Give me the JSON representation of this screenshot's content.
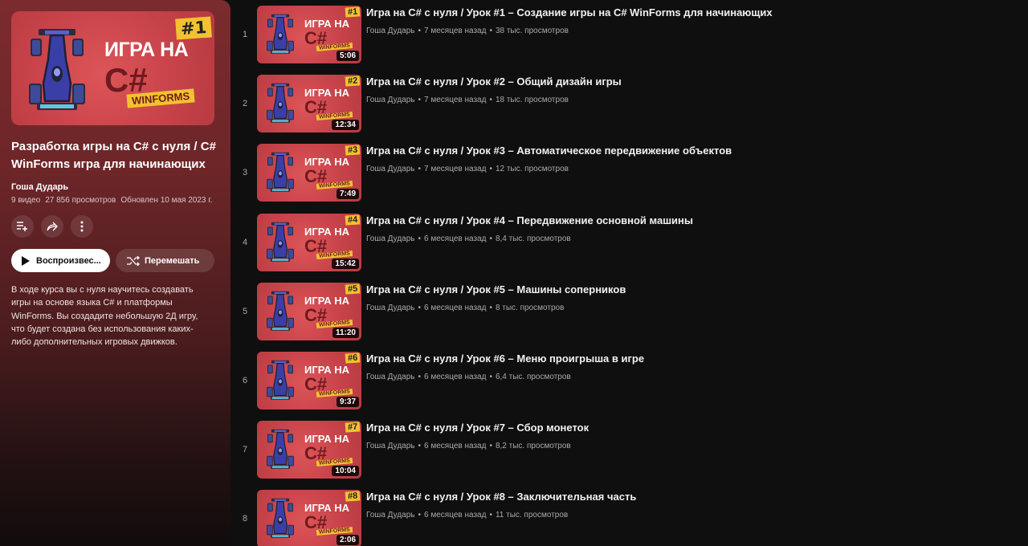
{
  "playlist": {
    "hero": {
      "badge": "#1",
      "title_line1": "ИГРА НА",
      "title_line2": "C#",
      "tag": "WINFORMS"
    },
    "title": "Разработка игры на C# с нуля / C# WinForms игра для начинающих",
    "author": "Гоша Дударь",
    "video_count": "9 видео",
    "views": "27 856 просмотров",
    "updated": "Обновлен 10 мая 2023 г.",
    "play_label": "Воспроизвес...",
    "shuffle_label": "Перемешать",
    "description": "В ходе курса вы с нуля научитесь создавать игры на основе языка C# и платформы WinForms. Вы создадите небольшую 2Д игру, что будет создана без использования каких-либо дополнительных игровых движков."
  },
  "thumb": {
    "line1": "ИГРА НА",
    "line2": "C#",
    "tag": "WINFORMS"
  },
  "videos": [
    {
      "index": "1",
      "badge": "#1",
      "duration": "5:06",
      "title": "Игра на C# с нуля / Урок #1 – Создание игры на C# WinForms для начинающих",
      "author": "Гоша Дударь",
      "age": "7 месяцев назад",
      "views": "38 тыс. просмотров"
    },
    {
      "index": "2",
      "badge": "#2",
      "duration": "12:34",
      "title": "Игра на C# с нуля / Урок #2 – Общий дизайн игры",
      "author": "Гоша Дударь",
      "age": "7 месяцев назад",
      "views": "18 тыс. просмотров"
    },
    {
      "index": "3",
      "badge": "#3",
      "duration": "7:49",
      "title": "Игра на C# с нуля / Урок #3 – Автоматическое передвижение объектов",
      "author": "Гоша Дударь",
      "age": "7 месяцев назад",
      "views": "12 тыс. просмотров"
    },
    {
      "index": "4",
      "badge": "#4",
      "duration": "15:42",
      "title": "Игра на C# с нуля / Урок #4 – Передвижение основной машины",
      "author": "Гоша Дударь",
      "age": "6 месяцев назад",
      "views": "8,4 тыс. просмотров"
    },
    {
      "index": "5",
      "badge": "#5",
      "duration": "11:20",
      "title": "Игра на C# с нуля / Урок #5 – Машины соперников",
      "author": "Гоша Дударь",
      "age": "6 месяцев назад",
      "views": "8 тыс. просмотров"
    },
    {
      "index": "6",
      "badge": "#6",
      "duration": "9:37",
      "title": "Игра на C# с нуля / Урок #6 – Меню проигрыша в игре",
      "author": "Гоша Дударь",
      "age": "6 месяцев назад",
      "views": "6,4 тыс. просмотров"
    },
    {
      "index": "7",
      "badge": "#7",
      "duration": "10:04",
      "title": "Игра на C# с нуля / Урок #7 – Сбор монеток",
      "author": "Гоша Дударь",
      "age": "6 месяцев назад",
      "views": "8,2 тыс. просмотров"
    },
    {
      "index": "8",
      "badge": "#8",
      "duration": "2:06",
      "title": "Игра на C# с нуля / Урок #8 – Заключительная часть",
      "author": "Гоша Дударь",
      "age": "6 месяцев назад",
      "views": "11 тыс. просмотров"
    }
  ],
  "icons": {
    "save": "playlist-add-icon",
    "share": "share-icon",
    "more": "more-vert-icon",
    "play": "play-icon",
    "shuffle": "shuffle-icon"
  },
  "colors": {
    "panel_top": "#7b2b2e",
    "thumb_bg": "#c8434a",
    "badge_yellow": "#f2c230",
    "car_blue": "#3a3fa8"
  }
}
